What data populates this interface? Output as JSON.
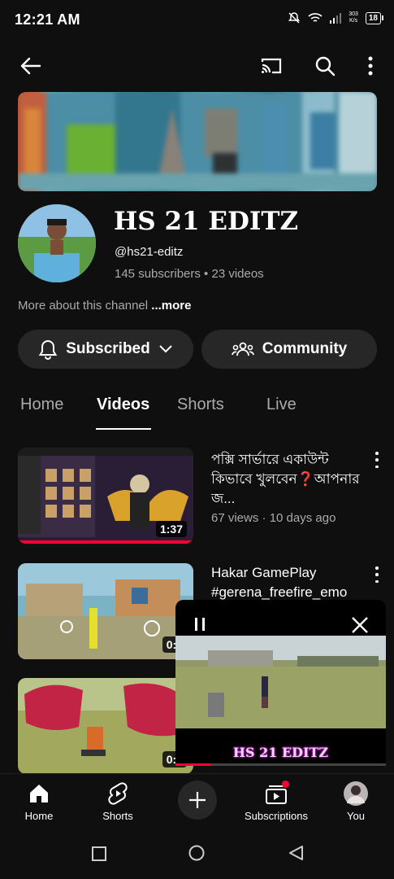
{
  "status_bar": {
    "time": "12:21 AM",
    "net_speed_top": "303",
    "net_speed_bottom": "K/s",
    "battery": "18"
  },
  "topbar": {
    "back": "back-arrow-icon",
    "cast": "cast-icon",
    "search": "search-icon",
    "menu": "more-vert-icon"
  },
  "channel": {
    "name": "HS 21 EDITZ",
    "handle": "@hs21-editz",
    "stats": "145 subscribers • 23 videos",
    "more_text": "More about this channel",
    "more_link": "...more"
  },
  "buttons": {
    "subscribed": "Subscribed",
    "community": "Community"
  },
  "tabs": [
    "Home",
    "Videos",
    "Shorts",
    "Live"
  ],
  "videos": [
    {
      "title": "পক্সি সার্ভারে একাউন্ট কিভাবে খুলবেন❓আপনার জ...",
      "meta": "67 views · 10 days ago",
      "duration": "1:37"
    },
    {
      "title": "Hakar GamePlay #gerena_freefire_emo",
      "meta": "",
      "duration": "0:3"
    },
    {
      "title": "",
      "meta": "",
      "duration": "0:3"
    }
  ],
  "miniplayer": {
    "label": "HS 21 EDITZ",
    "progress": 0.17
  },
  "bottom_nav": [
    "Home",
    "Shorts",
    "Subscriptions",
    "You"
  ],
  "colors": {
    "accent": "#ff0033",
    "bg": "#0f0f0f",
    "pill": "#272727"
  }
}
